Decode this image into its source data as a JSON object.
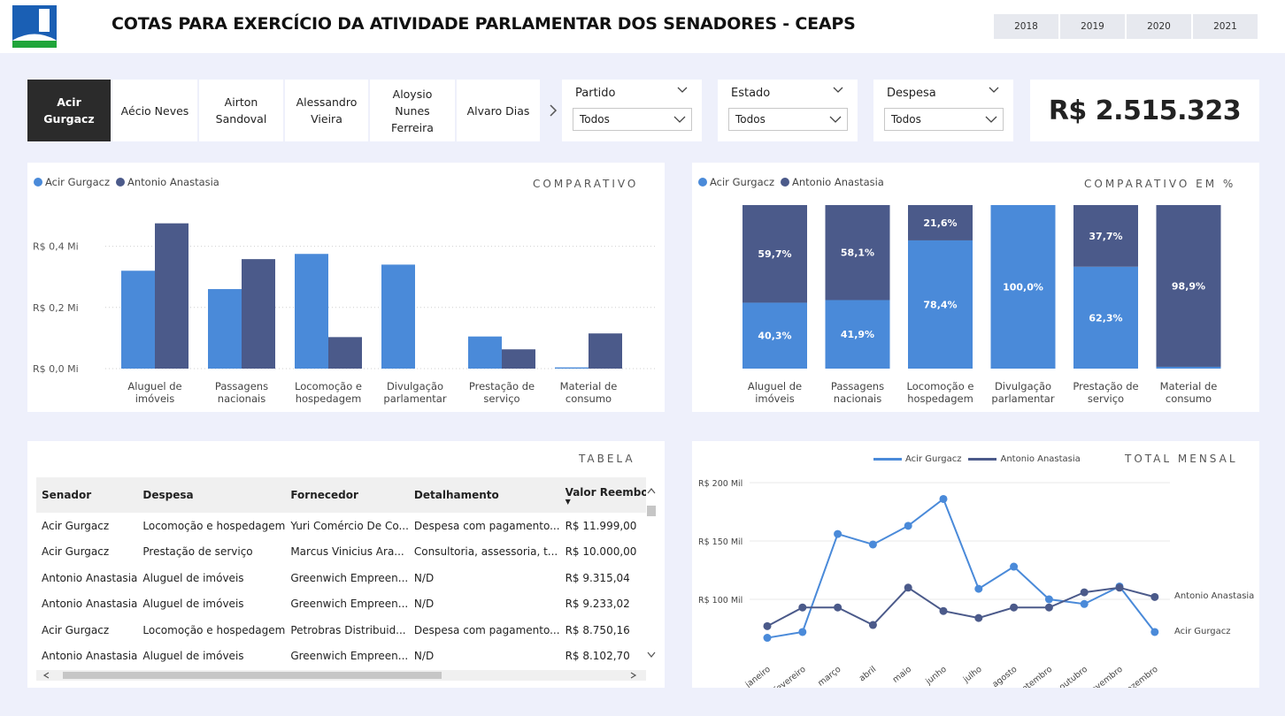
{
  "header": {
    "title": "COTAS PARA EXERCÍCIO DA ATIVIDADE PARLAMENTAR DOS SENADORES - CEAPS",
    "years": [
      "2018",
      "2019",
      "2020",
      "2021"
    ]
  },
  "senators": [
    {
      "label": "Acir\nGurgacz",
      "selected": true
    },
    {
      "label": "Aécio Neves",
      "selected": false
    },
    {
      "label": "Airton\nSandoval",
      "selected": false
    },
    {
      "label": "Alessandro\nVieira",
      "selected": false
    },
    {
      "label": "Aloysio\nNunes\nFerreira",
      "selected": false
    },
    {
      "label": "Alvaro Dias",
      "selected": false
    }
  ],
  "filters": [
    {
      "label": "Partido",
      "value": "Todos"
    },
    {
      "label": "Estado",
      "value": "Todos"
    },
    {
      "label": "Despesa",
      "value": "Todos"
    }
  ],
  "kpi": {
    "total": "R$ 2.515.323"
  },
  "colors": {
    "acir": "#4a8ad9",
    "antonio": "#4b5a8a",
    "page_bg": "#eef0fb"
  },
  "comparativo": {
    "title": "COMPARATIVO",
    "legend": [
      "Acir Gurgacz",
      "Antonio Anastasia"
    ]
  },
  "comparativo_pct": {
    "title": "COMPARATIVO EM %",
    "legend": [
      "Acir Gurgacz",
      "Antonio Anastasia"
    ]
  },
  "tabela": {
    "title": "TABELA",
    "columns": [
      "Senador",
      "Despesa",
      "Fornecedor",
      "Detalhamento",
      "Valor Reembolsado"
    ],
    "rows": [
      [
        "Acir Gurgacz",
        "Locomoção e hospedagem",
        "Yuri Comércio De Co...",
        "Despesa com pagamento...",
        "R$ 11.999,00"
      ],
      [
        "Acir Gurgacz",
        "Prestação de serviço",
        "Marcus Vinicius Ara...",
        "Consultoria, assessoria, t...",
        "R$ 10.000,00"
      ],
      [
        "Antonio Anastasia",
        "Aluguel de imóveis",
        "Greenwich Empreen...",
        "N/D",
        "R$ 9.315,04"
      ],
      [
        "Antonio Anastasia",
        "Aluguel de imóveis",
        "Greenwich Empreen...",
        "N/D",
        "R$ 9.233,02"
      ],
      [
        "Acir Gurgacz",
        "Locomoção e hospedagem",
        "Petrobras Distribuid...",
        "Despesa com pagamento...",
        "R$ 8.750,16"
      ],
      [
        "Antonio Anastasia",
        "Aluguel de imóveis",
        "Greenwich Empreen...",
        "N/D",
        "R$ 8.102,70"
      ]
    ]
  },
  "mensal": {
    "title": "TOTAL MENSAL",
    "legend": [
      "Acir Gurgacz",
      "Antonio Anastasia"
    ]
  },
  "chart_data": [
    {
      "type": "bar",
      "title": "COMPARATIVO",
      "categories": [
        "Aluguel de\nimóveis",
        "Passagens\nnacionais",
        "Locomoção e\nhospedagem",
        "Divulgação\nparlamentar",
        "Prestação de\nserviço",
        "Material de\nconsumo"
      ],
      "series": [
        {
          "name": "Acir Gurgacz",
          "values": [
            0.32,
            0.26,
            0.375,
            0.34,
            0.105,
            0.004
          ]
        },
        {
          "name": "Antonio Anastasia",
          "values": [
            0.475,
            0.358,
            0.103,
            0,
            0.063,
            0.115
          ]
        }
      ],
      "yticks": [
        "R$ 0,0 Mi",
        "R$ 0,2 Mi",
        "R$ 0,4 Mi"
      ],
      "ylim": [
        0,
        0.5
      ],
      "legend_position": "top-left"
    },
    {
      "type": "bar",
      "title": "COMPARATIVO EM %",
      "categories": [
        "Aluguel de\nimóveis",
        "Passagens\nnacionais",
        "Locomoção e\nhospedagem",
        "Divulgação\nparlamentar",
        "Prestação de\nserviço",
        "Material de\nconsumo"
      ],
      "series": [
        {
          "name": "Acir Gurgacz",
          "values": [
            40.3,
            41.9,
            78.4,
            100.0,
            62.3,
            1.1
          ],
          "labels": [
            "40,3%",
            "41,9%",
            "78,4%",
            "100,0%",
            "62,3%",
            ""
          ]
        },
        {
          "name": "Antonio Anastasia",
          "values": [
            59.7,
            58.1,
            21.6,
            0,
            37.7,
            98.9
          ],
          "labels": [
            "59,7%",
            "58,1%",
            "21,6%",
            "",
            "37,7%",
            "98,9%"
          ]
        }
      ],
      "stacked": true,
      "legend_position": "top-left"
    },
    {
      "type": "line",
      "title": "TOTAL MENSAL",
      "x": [
        "janeiro",
        "fevereiro",
        "março",
        "abril",
        "maio",
        "junho",
        "julho",
        "agosto",
        "setembro",
        "outubro",
        "novembro",
        "dezembro"
      ],
      "series": [
        {
          "name": "Acir Gurgacz",
          "values": [
            67,
            72,
            156,
            147,
            163,
            186,
            109,
            128,
            100,
            96,
            111,
            72
          ]
        },
        {
          "name": "Antonio Anastasia",
          "values": [
            77,
            93,
            93,
            78,
            110,
            90,
            84,
            93,
            93,
            106,
            110,
            102
          ]
        }
      ],
      "yticks": [
        "R$ 100 Mil",
        "R$ 150 Mil",
        "R$ 200 Mil"
      ],
      "ylim": [
        50,
        200
      ],
      "legend_position": "top",
      "end_labels": [
        "Acir Gurgacz",
        "Antonio Anastasia"
      ]
    }
  ]
}
